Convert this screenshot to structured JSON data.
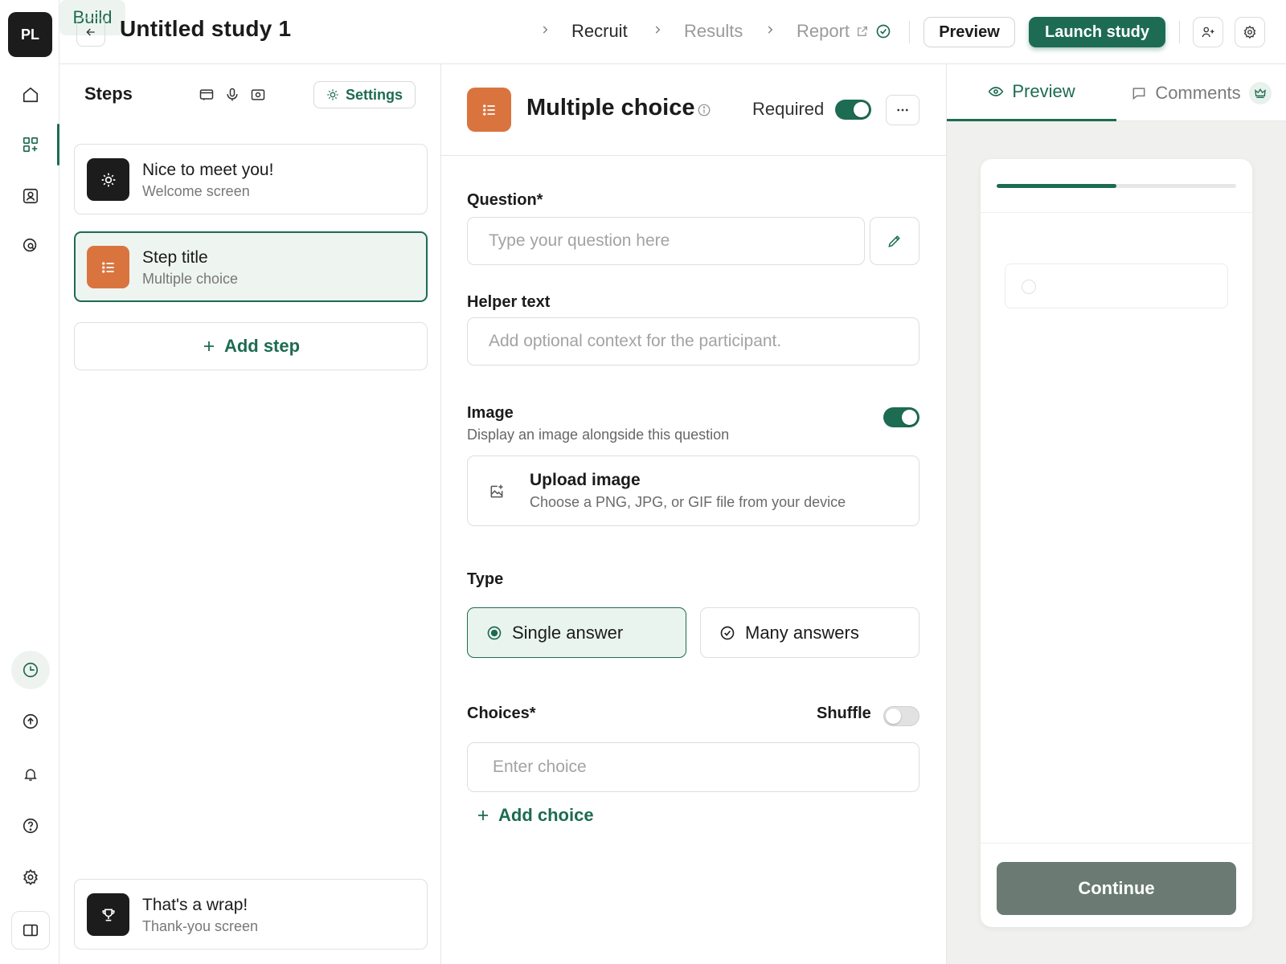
{
  "rail": {
    "avatar": "PL",
    "top_icons": [
      "home-icon",
      "layout-grid-icon",
      "contact-card-icon",
      "chart-search-icon"
    ],
    "bottom_icons": [
      "clock-icon",
      "upload-icon",
      "bell-icon",
      "help-icon",
      "gear-icon",
      "sidebar-toggle-icon"
    ]
  },
  "header": {
    "title": "Untitled study 1",
    "crumbs": {
      "build": "Build",
      "recruit": "Recruit",
      "results": "Results",
      "report": "Report"
    },
    "preview_label": "Preview",
    "launch_label": "Launch study"
  },
  "steps": {
    "title": "Steps",
    "settings_label": "Settings",
    "items": [
      {
        "name": "Nice to meet you!",
        "sub": "Welcome screen",
        "icon": "sun-icon"
      },
      {
        "name": "Step title",
        "sub": "Multiple choice",
        "icon": "list-icon",
        "selected": true
      }
    ],
    "add_step_label": "Add step",
    "final": {
      "name": "That's a wrap!",
      "sub": "Thank-you screen",
      "icon": "trophy-icon"
    }
  },
  "editor": {
    "title": "Multiple choice",
    "required_label": "Required",
    "required_on": true,
    "question_label": "Question*",
    "question_value": "",
    "question_placeholder": "Type your question here",
    "helper_label": "Helper text",
    "helper_value": "",
    "helper_placeholder": "Add optional context for the participant.",
    "image_label": "Image",
    "image_desc": "Display an image alongside this question",
    "image_on": true,
    "upload_title": "Upload image",
    "upload_sub": "Choose a PNG, JPG, or GIF file from your device",
    "type_label": "Type",
    "type_single": "Single answer",
    "type_many": "Many answers",
    "type_selected": "single",
    "choices_label": "Choices*",
    "shuffle_label": "Shuffle",
    "shuffle_on": false,
    "choice_value": "",
    "choice_placeholder": "Enter choice",
    "add_choice_label": "Add choice"
  },
  "preview": {
    "tab_preview": "Preview",
    "tab_comments": "Comments",
    "progress": 0.5,
    "continue_label": "Continue"
  },
  "colors": {
    "accent": "#1d6b52",
    "step_orange": "#d9743f",
    "dark": "#1c1c1c",
    "continue_disabled": "#6b7b73"
  }
}
